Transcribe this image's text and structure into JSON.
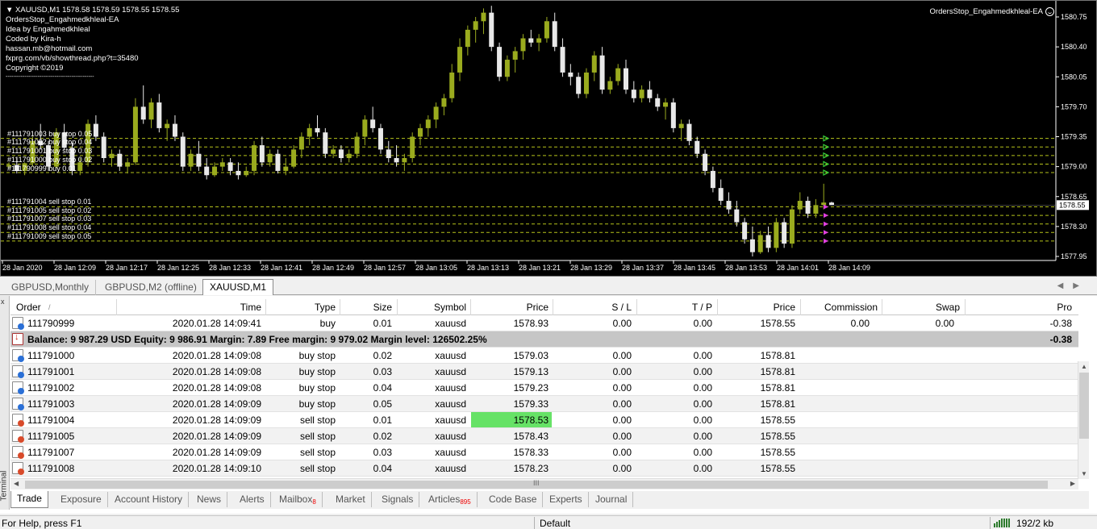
{
  "chart": {
    "symbol_header": "XAUUSD,M1  1578.58 1578.59 1578.55 1578.55",
    "info_lines": [
      "OrdersStop_Engahmedkhleal-EA",
      "Idea by Engahmedkhleal",
      "Coded by Kira-h",
      "hassan.mb@hotmail.com",
      "fxprg.com/vb/showthread.php?t=35480",
      "Copyright ©2019",
      "-----------------------------------------------"
    ],
    "ea_name": "OrdersStop_Engahmedkhleal-EA",
    "buy_stop_labels": [
      "#111791003 buy stop 0.05",
      "#111791002 buy stop 0.04",
      "#111791001 buy stop 0.03",
      "#111791000 buy stop 0.02",
      "#111790999 buy 0.01"
    ],
    "sell_stop_labels": [
      "#111791004 sell stop 0.01",
      "#111791005 sell stop 0.02",
      "#111791007 sell stop 0.03",
      "#111791008 sell stop 0.04",
      "#111791009 sell stop 0.05"
    ],
    "price_axis": [
      "1580.75",
      "1580.40",
      "1580.05",
      "1579.70",
      "1579.35",
      "1579.00",
      "1578.65",
      "1578.30",
      "1577.95"
    ],
    "current_price": "1578.55",
    "time_axis": [
      "28 Jan 2020",
      "28 Jan 12:09",
      "28 Jan 12:17",
      "28 Jan 12:25",
      "28 Jan 12:33",
      "28 Jan 12:41",
      "28 Jan 12:49",
      "28 Jan 12:57",
      "28 Jan 13:05",
      "28 Jan 13:13",
      "28 Jan 13:21",
      "28 Jan 13:29",
      "28 Jan 13:37",
      "28 Jan 13:45",
      "28 Jan 13:53",
      "28 Jan 14:01",
      "28 Jan 14:09"
    ],
    "colors": {
      "bull": "#9aab1e",
      "bear": "#e8e8e8",
      "grid_line": "#b5c21b",
      "buy_marker": "#38d038",
      "sell_marker": "#e040e0"
    },
    "buy_levels": [
      1579.33,
      1579.23,
      1579.13,
      1579.03,
      1578.93
    ],
    "sell_levels": [
      1578.53,
      1578.43,
      1578.33,
      1578.23,
      1578.13
    ],
    "candles": [
      [
        1579.0,
        1579.05,
        1578.98,
        1579.02
      ],
      [
        1579.02,
        1579.1,
        1578.92,
        1578.95
      ],
      [
        1578.95,
        1579.05,
        1578.9,
        1579.04
      ],
      [
        1579.04,
        1579.35,
        1579.0,
        1579.3
      ],
      [
        1579.3,
        1579.5,
        1579.2,
        1579.25
      ],
      [
        1579.25,
        1579.3,
        1578.95,
        1579.0
      ],
      [
        1579.0,
        1579.45,
        1578.98,
        1579.4
      ],
      [
        1579.4,
        1579.5,
        1579.2,
        1579.22
      ],
      [
        1579.22,
        1579.28,
        1578.9,
        1578.95
      ],
      [
        1578.95,
        1579.1,
        1578.9,
        1579.05
      ],
      [
        1579.05,
        1579.55,
        1579.0,
        1579.5
      ],
      [
        1579.5,
        1579.6,
        1579.3,
        1579.35
      ],
      [
        1579.35,
        1579.4,
        1579.05,
        1579.1
      ],
      [
        1579.1,
        1579.2,
        1579.0,
        1579.15
      ],
      [
        1579.15,
        1579.2,
        1578.95,
        1579.0
      ],
      [
        1579.0,
        1579.1,
        1578.92,
        1579.05
      ],
      [
        1579.05,
        1579.8,
        1579.02,
        1579.7
      ],
      [
        1579.7,
        1579.95,
        1579.5,
        1579.55
      ],
      [
        1579.55,
        1579.8,
        1579.45,
        1579.75
      ],
      [
        1579.75,
        1579.85,
        1579.4,
        1579.45
      ],
      [
        1579.45,
        1579.55,
        1579.3,
        1579.5
      ],
      [
        1579.5,
        1579.6,
        1579.3,
        1579.35
      ],
      [
        1579.35,
        1579.4,
        1578.95,
        1579.0
      ],
      [
        1579.0,
        1579.2,
        1578.95,
        1579.15
      ],
      [
        1579.15,
        1579.3,
        1578.95,
        1579.0
      ],
      [
        1579.0,
        1579.1,
        1578.85,
        1578.9
      ],
      [
        1578.9,
        1579.05,
        1578.88,
        1579.0
      ],
      [
        1579.0,
        1579.1,
        1578.95,
        1579.05
      ],
      [
        1579.05,
        1579.1,
        1578.9,
        1578.95
      ],
      [
        1578.95,
        1579.05,
        1578.85,
        1578.9
      ],
      [
        1578.9,
        1579.0,
        1578.88,
        1578.95
      ],
      [
        1578.95,
        1579.3,
        1578.9,
        1579.25
      ],
      [
        1579.25,
        1579.35,
        1579.0,
        1579.05
      ],
      [
        1579.05,
        1579.2,
        1579.0,
        1579.15
      ],
      [
        1579.15,
        1579.2,
        1578.92,
        1578.95
      ],
      [
        1578.95,
        1579.1,
        1578.9,
        1579.0
      ],
      [
        1579.0,
        1579.25,
        1578.98,
        1579.2
      ],
      [
        1579.2,
        1579.4,
        1579.1,
        1579.35
      ],
      [
        1579.35,
        1579.5,
        1579.25,
        1579.45
      ],
      [
        1579.45,
        1579.6,
        1579.35,
        1579.4
      ],
      [
        1579.4,
        1579.45,
        1579.1,
        1579.15
      ],
      [
        1579.15,
        1579.25,
        1579.1,
        1579.2
      ],
      [
        1579.2,
        1579.25,
        1579.05,
        1579.1
      ],
      [
        1579.1,
        1579.2,
        1579.05,
        1579.15
      ],
      [
        1579.15,
        1579.4,
        1579.1,
        1579.35
      ],
      [
        1579.35,
        1579.6,
        1579.25,
        1579.55
      ],
      [
        1579.55,
        1579.7,
        1579.4,
        1579.45
      ],
      [
        1579.45,
        1579.5,
        1579.15,
        1579.2
      ],
      [
        1579.2,
        1579.3,
        1579.05,
        1579.1
      ],
      [
        1579.1,
        1579.25,
        1579.0,
        1579.05
      ],
      [
        1579.05,
        1579.15,
        1578.95,
        1579.1
      ],
      [
        1579.1,
        1579.4,
        1579.05,
        1579.35
      ],
      [
        1579.35,
        1579.5,
        1579.25,
        1579.45
      ],
      [
        1579.45,
        1579.6,
        1579.35,
        1579.55
      ],
      [
        1579.55,
        1579.75,
        1579.45,
        1579.7
      ],
      [
        1579.7,
        1579.85,
        1579.6,
        1579.8
      ],
      [
        1579.8,
        1580.2,
        1579.75,
        1580.1
      ],
      [
        1580.1,
        1580.5,
        1580.0,
        1580.4
      ],
      [
        1580.4,
        1580.65,
        1580.3,
        1580.6
      ],
      [
        1580.6,
        1580.75,
        1580.45,
        1580.7
      ],
      [
        1580.7,
        1580.85,
        1580.55,
        1580.8
      ],
      [
        1580.8,
        1580.88,
        1580.35,
        1580.4
      ],
      [
        1580.4,
        1580.45,
        1580.0,
        1580.05
      ],
      [
        1580.05,
        1580.3,
        1580.0,
        1580.25
      ],
      [
        1580.25,
        1580.4,
        1580.1,
        1580.35
      ],
      [
        1580.35,
        1580.55,
        1580.25,
        1580.5
      ],
      [
        1580.5,
        1580.6,
        1580.4,
        1580.45
      ],
      [
        1580.45,
        1580.55,
        1580.35,
        1580.5
      ],
      [
        1580.5,
        1580.75,
        1580.45,
        1580.7
      ],
      [
        1580.7,
        1580.8,
        1580.35,
        1580.4
      ],
      [
        1580.4,
        1580.5,
        1580.05,
        1580.1
      ],
      [
        1580.1,
        1580.2,
        1579.95,
        1580.05
      ],
      [
        1580.05,
        1580.1,
        1579.8,
        1579.85
      ],
      [
        1579.85,
        1580.15,
        1579.8,
        1580.1
      ],
      [
        1580.1,
        1580.35,
        1580.0,
        1580.3
      ],
      [
        1580.3,
        1580.4,
        1579.85,
        1579.9
      ],
      [
        1579.9,
        1580.05,
        1579.85,
        1580.0
      ],
      [
        1580.0,
        1580.2,
        1579.95,
        1580.15
      ],
      [
        1580.15,
        1580.25,
        1579.85,
        1579.9
      ],
      [
        1579.9,
        1580.0,
        1579.75,
        1579.8
      ],
      [
        1579.8,
        1579.95,
        1579.75,
        1579.9
      ],
      [
        1579.9,
        1580.0,
        1579.75,
        1579.8
      ],
      [
        1579.8,
        1579.85,
        1579.65,
        1579.7
      ],
      [
        1579.7,
        1579.8,
        1579.55,
        1579.75
      ],
      [
        1579.75,
        1579.8,
        1579.4,
        1579.45
      ],
      [
        1579.45,
        1579.55,
        1579.3,
        1579.5
      ],
      [
        1579.5,
        1579.55,
        1579.25,
        1579.3
      ],
      [
        1579.3,
        1579.35,
        1579.1,
        1579.15
      ],
      [
        1579.15,
        1579.2,
        1578.9,
        1578.95
      ],
      [
        1578.95,
        1579.0,
        1578.7,
        1578.75
      ],
      [
        1578.75,
        1578.85,
        1578.55,
        1578.6
      ],
      [
        1578.6,
        1578.7,
        1578.45,
        1578.5
      ],
      [
        1578.5,
        1578.6,
        1578.3,
        1578.35
      ],
      [
        1578.35,
        1578.4,
        1578.1,
        1578.15
      ],
      [
        1578.15,
        1578.3,
        1577.95,
        1578.0
      ],
      [
        1578.0,
        1578.25,
        1577.98,
        1578.2
      ],
      [
        1578.2,
        1578.3,
        1578.0,
        1578.05
      ],
      [
        1578.05,
        1578.4,
        1578.0,
        1578.35
      ],
      [
        1578.35,
        1578.4,
        1578.05,
        1578.1
      ],
      [
        1578.1,
        1578.55,
        1578.05,
        1578.5
      ],
      [
        1578.5,
        1578.7,
        1578.45,
        1578.6
      ],
      [
        1578.6,
        1578.65,
        1578.4,
        1578.45
      ],
      [
        1578.45,
        1578.62,
        1578.4,
        1578.55
      ],
      [
        1578.55,
        1578.8,
        1578.5,
        1578.58
      ],
      [
        1578.58,
        1578.59,
        1578.55,
        1578.55
      ]
    ]
  },
  "chart_tabs": [
    "GBPUSD,Monthly",
    "GBPUSD,M2 (offline)",
    "XAUUSD,M1"
  ],
  "terminal": {
    "side_label": "Terminal",
    "close_label": "x",
    "columns": [
      "Order",
      "/",
      "Time",
      "Type",
      "Size",
      "Symbol",
      "Price",
      "S / L",
      "T / P",
      "Price",
      "Commission",
      "Swap",
      "Pro"
    ],
    "open_row": {
      "order": "111790999",
      "time": "2020.01.28 14:09:41",
      "type": "buy",
      "size": "0.01",
      "symbol": "xauusd",
      "price": "1578.93",
      "sl": "0.00",
      "tp": "0.00",
      "cur_price": "1578.55",
      "commission": "0.00",
      "swap": "0.00",
      "profit": "-0.38"
    },
    "balance_row": {
      "text": "Balance: 9 987.29 USD  Equity: 9 986.91  Margin: 7.89  Free margin: 9 979.02  Margin level: 126502.25%",
      "profit": "-0.38"
    },
    "pending": [
      {
        "order": "111791000",
        "time": "2020.01.28 14:09:08",
        "type": "buy stop",
        "size": "0.02",
        "symbol": "xauusd",
        "price": "1579.03",
        "sl": "0.00",
        "tp": "0.00",
        "cur_price": "1578.81",
        "side": "buy"
      },
      {
        "order": "111791001",
        "time": "2020.01.28 14:09:08",
        "type": "buy stop",
        "size": "0.03",
        "symbol": "xauusd",
        "price": "1579.13",
        "sl": "0.00",
        "tp": "0.00",
        "cur_price": "1578.81",
        "side": "buy"
      },
      {
        "order": "111791002",
        "time": "2020.01.28 14:09:08",
        "type": "buy stop",
        "size": "0.04",
        "symbol": "xauusd",
        "price": "1579.23",
        "sl": "0.00",
        "tp": "0.00",
        "cur_price": "1578.81",
        "side": "buy"
      },
      {
        "order": "111791003",
        "time": "2020.01.28 14:09:09",
        "type": "buy stop",
        "size": "0.05",
        "symbol": "xauusd",
        "price": "1579.33",
        "sl": "0.00",
        "tp": "0.00",
        "cur_price": "1578.81",
        "side": "buy"
      },
      {
        "order": "111791004",
        "time": "2020.01.28 14:09:09",
        "type": "sell stop",
        "size": "0.01",
        "symbol": "xauusd",
        "price": "1578.53",
        "sl": "0.00",
        "tp": "0.00",
        "cur_price": "1578.55",
        "side": "sell",
        "highlight": true
      },
      {
        "order": "111791005",
        "time": "2020.01.28 14:09:09",
        "type": "sell stop",
        "size": "0.02",
        "symbol": "xauusd",
        "price": "1578.43",
        "sl": "0.00",
        "tp": "0.00",
        "cur_price": "1578.55",
        "side": "sell"
      },
      {
        "order": "111791007",
        "time": "2020.01.28 14:09:09",
        "type": "sell stop",
        "size": "0.03",
        "symbol": "xauusd",
        "price": "1578.33",
        "sl": "0.00",
        "tp": "0.00",
        "cur_price": "1578.55",
        "side": "sell"
      },
      {
        "order": "111791008",
        "time": "2020.01.28 14:09:10",
        "type": "sell stop",
        "size": "0.04",
        "symbol": "xauusd",
        "price": "1578.23",
        "sl": "0.00",
        "tp": "0.00",
        "cur_price": "1578.55",
        "side": "sell"
      }
    ],
    "highlight_color": "#66e266",
    "scroll_grip": "III",
    "tabs": [
      {
        "label": "Trade",
        "active": true
      },
      {
        "label": "Exposure"
      },
      {
        "label": "Account History"
      },
      {
        "label": "News"
      },
      {
        "label": "Alerts"
      },
      {
        "label": "Mailbox",
        "badge": "8"
      },
      {
        "label": "Market"
      },
      {
        "label": "Signals"
      },
      {
        "label": "Articles",
        "badge": "895"
      },
      {
        "label": "Code Base"
      },
      {
        "label": "Experts"
      },
      {
        "label": "Journal"
      }
    ]
  },
  "status": {
    "help": "For Help, press F1",
    "profile": "Default",
    "traffic": "192/2 kb"
  }
}
